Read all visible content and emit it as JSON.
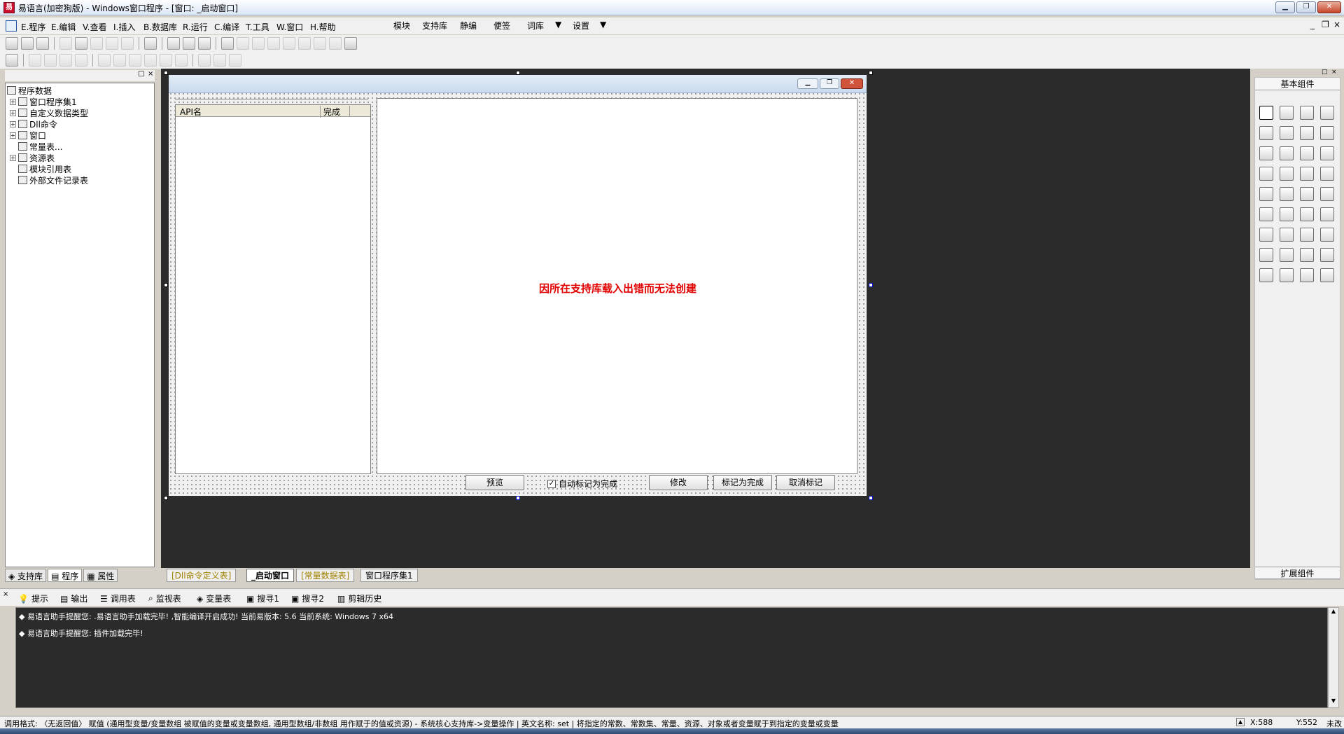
{
  "window": {
    "title": "易语言(加密狗版) - Windows窗口程序 - [窗口: _启动窗口]",
    "controls": {
      "minimize": "▁",
      "restore": "❐",
      "close": "✕"
    }
  },
  "menu": {
    "items": [
      "E.程序",
      "E.编辑",
      "V.查看",
      "I.插入",
      "B.数据库",
      "R.运行",
      "C.编译",
      "T.工具",
      "W.窗口",
      "H.帮助"
    ],
    "extra": [
      "模块",
      "支持库",
      "静编",
      "便签",
      "词库",
      "设置"
    ],
    "mdi": [
      "_",
      "❐",
      "×"
    ]
  },
  "left_panel": {
    "root": "程序数据",
    "items": [
      "窗口程序集1",
      "自定义数据类型",
      "Dll命令",
      "窗口",
      "常量表...",
      "资源表",
      "模块引用表",
      "外部文件记录表"
    ],
    "tabs": [
      "支持库",
      "程序",
      "属性"
    ]
  },
  "design": {
    "list_headers": [
      "API名",
      "完成"
    ],
    "error_text": "因所在支持库载入出错而无法创建",
    "buttons": {
      "preview": "预览",
      "auto_mark": "自动标记为完成",
      "modify": "修改",
      "mark_done": "标记为完成",
      "unmark": "取消标记"
    }
  },
  "right_panel": {
    "title": "基本组件",
    "footer": "扩展组件"
  },
  "doc_tabs": [
    "[Dll命令定义表]",
    "_启动窗口",
    "[常量数据表]",
    "窗口程序集1"
  ],
  "output_tabs": [
    "提示",
    "输出",
    "调用表",
    "监视表",
    "变量表",
    "搜寻1",
    "搜寻2",
    "剪辑历史"
  ],
  "output_lines": [
    "易语言助手提醒您: .易语言助手加载完毕! ,智能编译开启成功! 当前易版本: 5.6 当前系统: Windows 7 x64",
    "易语言助手提醒您: 插件加载完毕!"
  ],
  "status": {
    "text": "调用格式: 〈无返回值〉 赋值 (通用型变量/变量数组 被赋值的变量或变量数组, 通用型数组/非数组 用作赋于的值或资源) - 系统核心支持库->变量操作 | 英文名称: set | 将指定的常数、常数集、常量、资源、对象或者变量赋于到指定的变量或变量",
    "x": "X:588",
    "y": "Y:552",
    "state": "未改"
  },
  "colors": {
    "error": "#e00000",
    "canvas": "#2b2b2b"
  }
}
